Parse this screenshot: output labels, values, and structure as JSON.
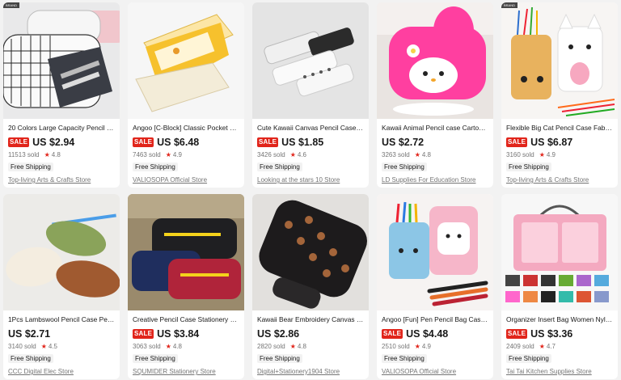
{
  "products": [
    {
      "title": "20 Colors Large Capacity Pencil Ca...",
      "sale": true,
      "sale_label": "SALE",
      "price": "US $2.94",
      "sold": "11513 sold",
      "rating": "4.8",
      "shipping": "Free Shipping",
      "store": "Top-living Arts & Crafts Store",
      "image": "grid-pencil-cases-icon"
    },
    {
      "title": "Angoo [C-Block] Classic Pocket Pen...",
      "sale": true,
      "sale_label": "SALE",
      "price": "US $6.48",
      "sold": "7463 sold",
      "rating": "4.9",
      "shipping": "Free Shipping",
      "store": "VALIOSOPA Official Store",
      "image": "yellow-pencil-case-icon"
    },
    {
      "title": "Cute Kawaii Canvas Pencil Case Hi...",
      "sale": true,
      "sale_label": "SALE",
      "price": "US $1.85",
      "sold": "3426 sold",
      "rating": "4.6",
      "shipping": "Free Shipping",
      "store": "Looking at the stars 10 Store",
      "image": "canvas-pencil-cases-icon"
    },
    {
      "title": "Kawaii Animal Pencil case Cartoon ...",
      "sale": false,
      "sale_label": "",
      "price": "US $2.72",
      "sold": "3263 sold",
      "rating": "4.8",
      "shipping": "Free Shipping",
      "store": "LD Supplies For Education Store",
      "image": "pink-bunny-case-icon"
    },
    {
      "title": "Flexible Big Cat Pencil Case Fabric ...",
      "sale": true,
      "sale_label": "SALE",
      "price": "US $6.87",
      "sold": "3160 sold",
      "rating": "4.9",
      "shipping": "Free Shipping",
      "store": "Top-living Arts & Crafts Store",
      "image": "cat-pencil-cases-icon"
    },
    {
      "title": "1Pcs Lambswool Pencil Case Pen P...",
      "sale": false,
      "sale_label": "",
      "price": "US $2.71",
      "sold": "3140 sold",
      "rating": "4.5",
      "shipping": "Free Shipping",
      "store": "CCC Digital Elec Store",
      "image": "fluffy-pencil-cases-icon"
    },
    {
      "title": "Creative Pencil Case Stationery Cut...",
      "sale": true,
      "sale_label": "SALE",
      "price": "US $3.84",
      "sold": "3063 sold",
      "rating": "4.8",
      "shipping": "Free Shipping",
      "store": "SQUMIDER Stationery Store",
      "image": "colored-pencil-cases-icon"
    },
    {
      "title": "Kawaii Bear Embroidery Canvas Pe...",
      "sale": false,
      "sale_label": "",
      "price": "US $2.86",
      "sold": "2820 sold",
      "rating": "4.8",
      "shipping": "Free Shipping",
      "store": "Digital+Stationery1904 Store",
      "image": "black-bear-case-icon"
    },
    {
      "title": "Angoo [Fun] Pen Pencil Bag Case, ...",
      "sale": true,
      "sale_label": "SALE",
      "price": "US $4.48",
      "sold": "2510 sold",
      "rating": "4.9",
      "shipping": "Free Shipping",
      "store": "VALIOSOPA Official Store",
      "image": "cat-pen-bag-icon"
    },
    {
      "title": "Organizer Insert Bag Women Nylo...",
      "sale": true,
      "sale_label": "SALE",
      "price": "US $3.36",
      "sold": "2409 sold",
      "rating": "4.7",
      "shipping": "Free Shipping",
      "store": "Tai Tai Kitchen Supplies Store",
      "image": "organizer-bag-icon"
    }
  ],
  "colors": {
    "sale": "#e1251b",
    "star": "#e1251b",
    "background": "#f2f2f2"
  }
}
